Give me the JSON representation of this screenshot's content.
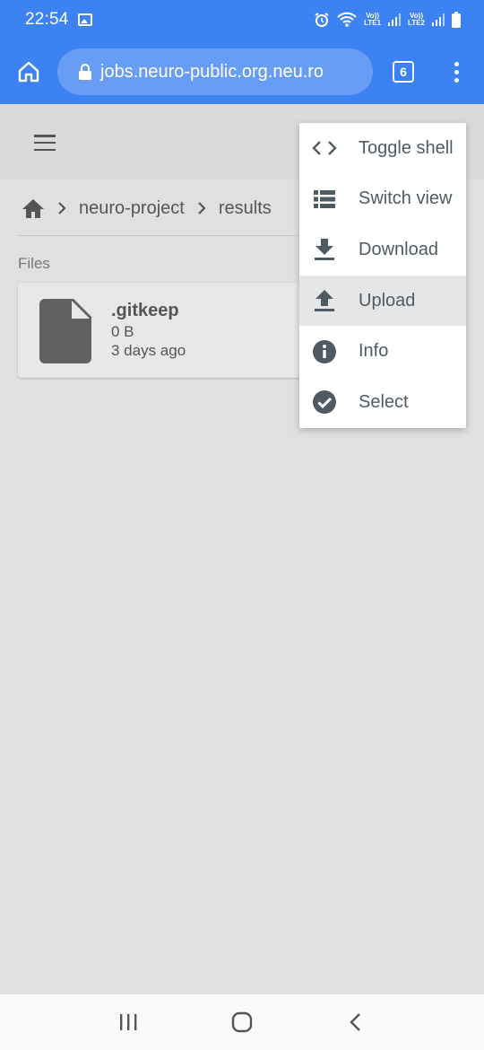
{
  "status_bar": {
    "time": "22:54",
    "network1": {
      "top": "Vo))",
      "bottom": "LTE1"
    },
    "network2": {
      "top": "Vo))",
      "bottom": "LTE2"
    }
  },
  "browser": {
    "url": "jobs.neuro-public.org.neu.ro",
    "tab_count": "6"
  },
  "breadcrumb": {
    "items": [
      "neuro-project",
      "results"
    ]
  },
  "files_section": {
    "label": "Files",
    "files": [
      {
        "name": ".gitkeep",
        "size": "0 B",
        "modified": "3 days ago"
      }
    ]
  },
  "context_menu": {
    "items": [
      {
        "label": "Toggle shell",
        "icon": "code-icon"
      },
      {
        "label": "Switch view",
        "icon": "list-view-icon"
      },
      {
        "label": "Download",
        "icon": "download-icon"
      },
      {
        "label": "Upload",
        "icon": "upload-icon",
        "highlighted": true
      },
      {
        "label": "Info",
        "icon": "info-icon"
      },
      {
        "label": "Select",
        "icon": "check-circle-icon"
      }
    ]
  },
  "colors": {
    "browser_blue": "#3d82f2",
    "menu_icon": "#4f5b62",
    "background": "#e0e0e0"
  }
}
